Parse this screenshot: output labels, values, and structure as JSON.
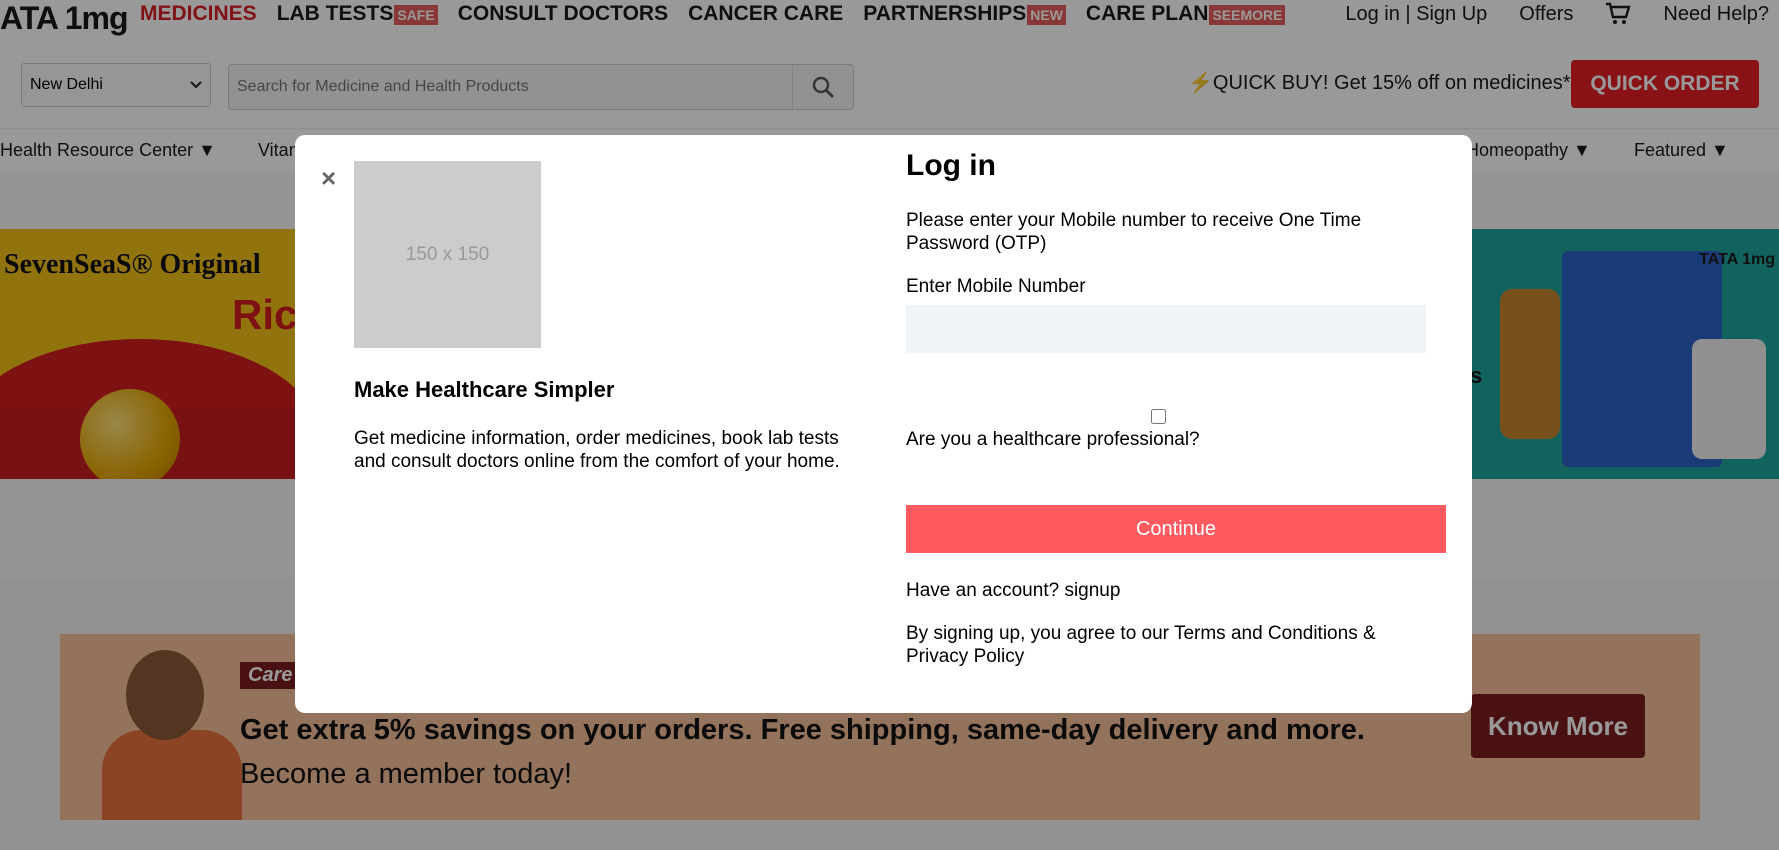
{
  "header": {
    "logo_text": "ATA 1mg",
    "nav": [
      {
        "label": "MEDICINES",
        "badge": ""
      },
      {
        "label": "LAB TESTS",
        "badge": "SAFE"
      },
      {
        "label": "CONSULT DOCTORS",
        "badge": ""
      },
      {
        "label": "CANCER CARE",
        "badge": ""
      },
      {
        "label": "PARTNERSHIPS",
        "badge": "NEW"
      },
      {
        "label": "CARE PLAN",
        "badge": "SEEMORE"
      }
    ],
    "login": "Log in | Sign Up",
    "offers": "Offers",
    "help": "Need Help?"
  },
  "search": {
    "city": "New Delhi",
    "placeholder": "Search for Medicine and Health Products",
    "promo": "⚡QUICK BUY! Get 15% off on medicines*",
    "quick_order": "QUICK ORDER"
  },
  "categories": [
    "Health Resource Center ▼",
    "Vitan",
    "Homeopathy ▼",
    "Featured ▼"
  ],
  "banners": {
    "left_brand": "SevenSeaS® Original",
    "left_partial": "Ric",
    "right_brand": "TATA 1mg",
    "right_partial": "s"
  },
  "care_banner": {
    "logo": "Care",
    "line1": "Get extra 5% savings on your orders. Free shipping, same-day delivery and more.",
    "line2": "Become a member today!",
    "cta": "Know More"
  },
  "modal": {
    "close": "×",
    "image_placeholder": "150 x 150",
    "left_title": "Make Healthcare Simpler",
    "left_desc": "Get medicine information, order medicines, book lab tests and consult doctors online from the comfort of your home.",
    "title": "Log in",
    "otp_text": "Please enter your Mobile number to receive One Time Password (OTP)",
    "mobile_label": "Enter Mobile Number",
    "mobile_value": "",
    "hp_label": "Are you a healthcare professional?",
    "continue": "Continue",
    "have_account": "Have an account? signup",
    "terms": "By signing up, you agree to our Terms and Conditions & Privacy Policy"
  },
  "colors": {
    "brand_red": "#e31e24",
    "continue_btn": "#ff5a60",
    "care_maroon": "#7a1d1d"
  }
}
